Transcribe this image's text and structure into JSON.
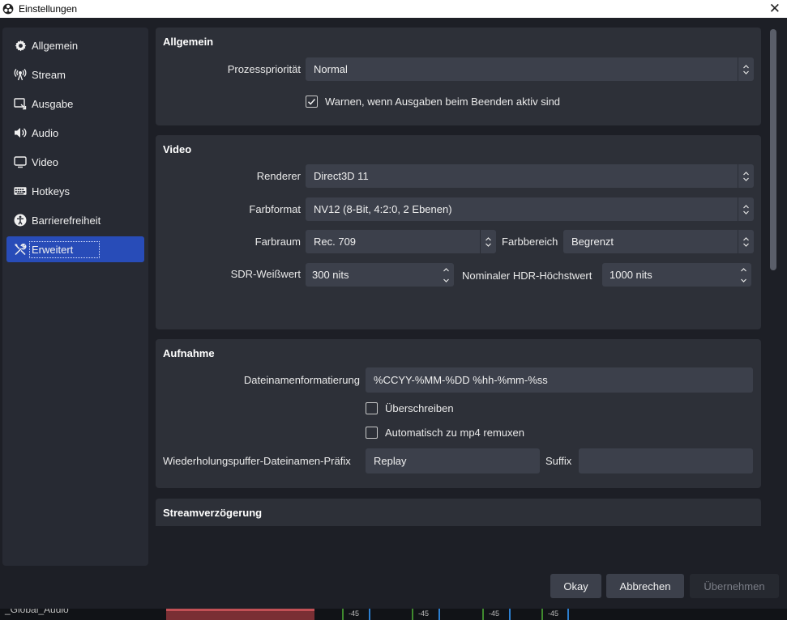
{
  "window": {
    "title": "Einstellungen"
  },
  "sidebar": {
    "items": [
      {
        "label": "Allgemein",
        "icon": "gear-icon"
      },
      {
        "label": "Stream",
        "icon": "antenna-icon"
      },
      {
        "label": "Ausgabe",
        "icon": "output-icon"
      },
      {
        "label": "Audio",
        "icon": "speaker-icon"
      },
      {
        "label": "Video",
        "icon": "monitor-icon"
      },
      {
        "label": "Hotkeys",
        "icon": "keyboard-icon"
      },
      {
        "label": "Barrierefreiheit",
        "icon": "accessibility-icon"
      },
      {
        "label": "Erweitert",
        "icon": "tools-icon"
      }
    ],
    "active": "Erweitert",
    "accent": "#284cb8"
  },
  "general": {
    "title": "Allgemein",
    "priority_label": "Prozesspriorität",
    "priority_value": "Normal",
    "warn_label": "Warnen, wenn Ausgaben beim Beenden aktiv sind",
    "warn_checked": true
  },
  "video": {
    "title": "Video",
    "renderer_label": "Renderer",
    "renderer_value": "Direct3D 11",
    "format_label": "Farbformat",
    "format_value": "NV12 (8-Bit, 4:2:0, 2 Ebenen)",
    "space_label": "Farbraum",
    "space_value": "Rec. 709",
    "range_label": "Farbbereich",
    "range_value": "Begrenzt",
    "sdr_label": "SDR-Weißwert",
    "sdr_value": "300 nits",
    "hdr_label": "Nominaler HDR-Höchstwert",
    "hdr_value": "1000 nits"
  },
  "recording": {
    "title": "Aufnahme",
    "filename_label": "Dateinamenformatierung",
    "filename_value": "%CCYY-%MM-%DD %hh-%mm-%ss",
    "overwrite_label": "Überschreiben",
    "overwrite_checked": false,
    "remux_label": "Automatisch zu mp4 remuxen",
    "remux_checked": false,
    "replay_prefix_label": "Wiederholungspuffer-Dateinamen-Präfix",
    "replay_prefix_value": "Replay",
    "suffix_label": "Suffix",
    "suffix_value": ""
  },
  "stream_delay": {
    "title": "Streamverzögerung"
  },
  "buttons": {
    "ok": "Okay",
    "cancel": "Abbrechen",
    "apply": "Übernehmen"
  },
  "background": {
    "global_audio": "_Global_Audio",
    "meter_label": "-45"
  }
}
